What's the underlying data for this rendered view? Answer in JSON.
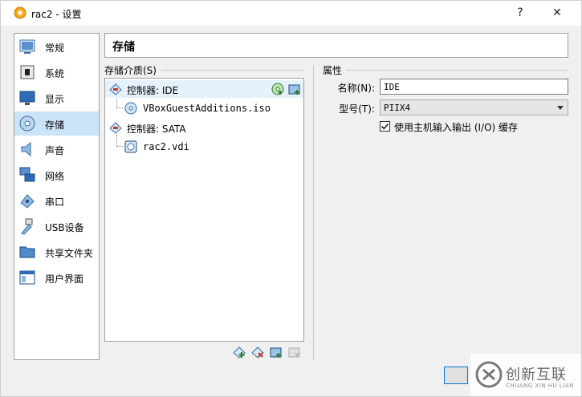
{
  "window": {
    "title": "rac2 - 设置",
    "help_label": "?",
    "close_label": "✕"
  },
  "sidebar": {
    "items": [
      {
        "label": "常规",
        "icon": "general-icon"
      },
      {
        "label": "系统",
        "icon": "system-icon"
      },
      {
        "label": "显示",
        "icon": "display-icon"
      },
      {
        "label": "存储",
        "icon": "storage-icon",
        "active": true
      },
      {
        "label": "声音",
        "icon": "audio-icon"
      },
      {
        "label": "网络",
        "icon": "network-icon"
      },
      {
        "label": "串口",
        "icon": "serial-port-icon"
      },
      {
        "label": "USB设备",
        "icon": "usb-icon"
      },
      {
        "label": "共享文件夹",
        "icon": "shared-folder-icon"
      },
      {
        "label": "用户界面",
        "icon": "user-interface-icon"
      }
    ]
  },
  "page": {
    "heading": "存储"
  },
  "storage_tree": {
    "group_label": "存储介质(S)",
    "rows": [
      {
        "label": "控制器: IDE",
        "kind": "controller"
      },
      {
        "label": "VBoxGuestAdditions.iso",
        "kind": "optical"
      },
      {
        "label": "控制器: SATA",
        "kind": "controller"
      },
      {
        "label": "rac2.vdi",
        "kind": "hard-disk"
      }
    ]
  },
  "attributes": {
    "group_label": "属性",
    "name_label": "名称(N):",
    "name_value": "IDE",
    "type_label": "型号(T):",
    "type_value": "PIIX4",
    "host_io_cache_label": "使用主机输入输出 (I/O) 缓存",
    "host_io_cache_checked": true
  },
  "watermark": {
    "text": "创新互联",
    "subtext": "CHUANG XIN HU LIAN"
  },
  "colors": {
    "selection": "#cce4f7",
    "tree_selection": "#e5f1fb",
    "accent": "#0078d7"
  }
}
